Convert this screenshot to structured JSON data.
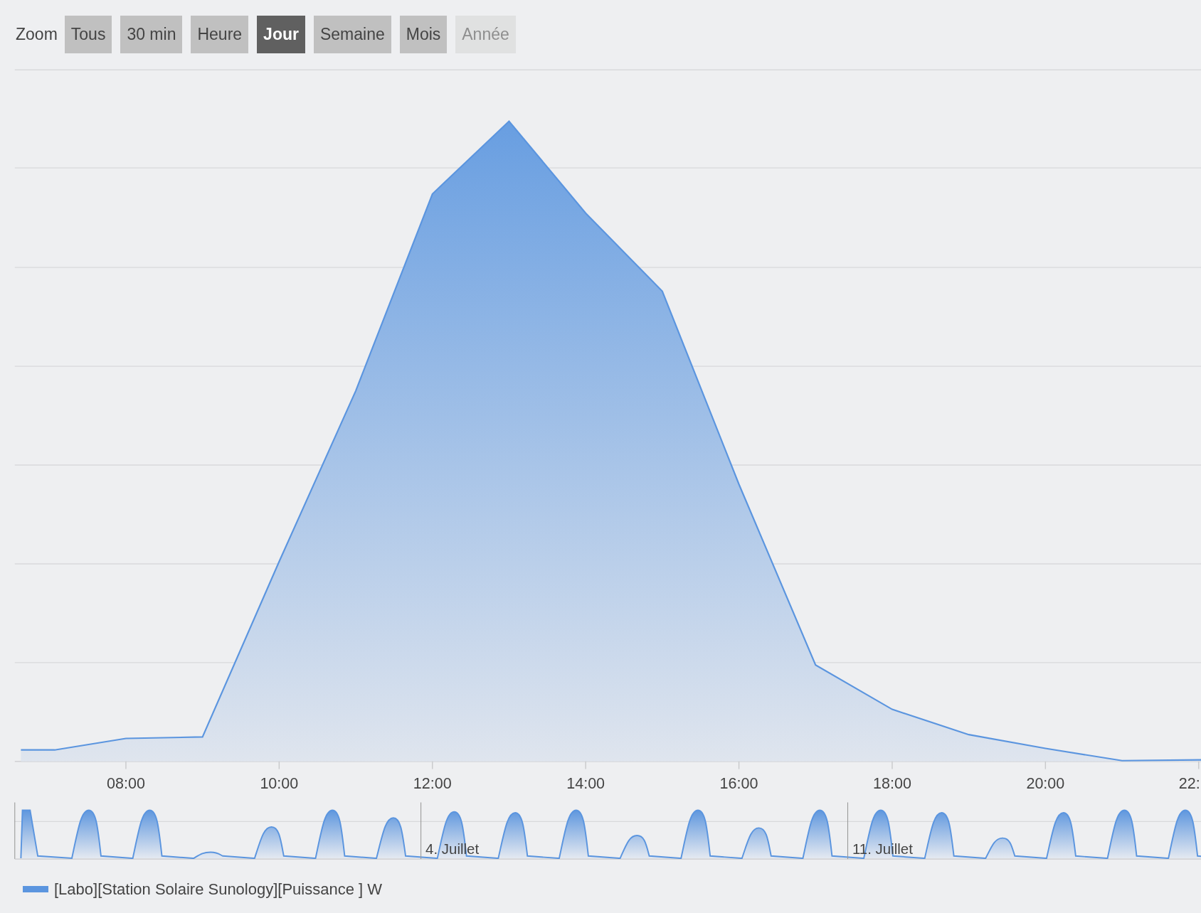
{
  "toolbar": {
    "label": "Zoom",
    "buttons": [
      {
        "label": "Tous",
        "selected": false,
        "disabled": false
      },
      {
        "label": "30 min",
        "selected": false,
        "disabled": false
      },
      {
        "label": "Heure",
        "selected": false,
        "disabled": false
      },
      {
        "label": "Jour",
        "selected": true,
        "disabled": false
      },
      {
        "label": "Semaine",
        "selected": false,
        "disabled": false
      },
      {
        "label": "Mois",
        "selected": false,
        "disabled": false
      },
      {
        "label": "Année",
        "selected": false,
        "disabled": true
      }
    ]
  },
  "chart": {
    "x_axis_labels": [
      "08:00",
      "10:00",
      "12:00",
      "14:00",
      "16:00",
      "18:00",
      "20:00",
      "22:"
    ],
    "navigator_labels": [
      "4. Juillet",
      "11. Juillet"
    ]
  },
  "legend": {
    "label": "[Labo][Station Solaire Sunology][Puissance ] W"
  }
}
